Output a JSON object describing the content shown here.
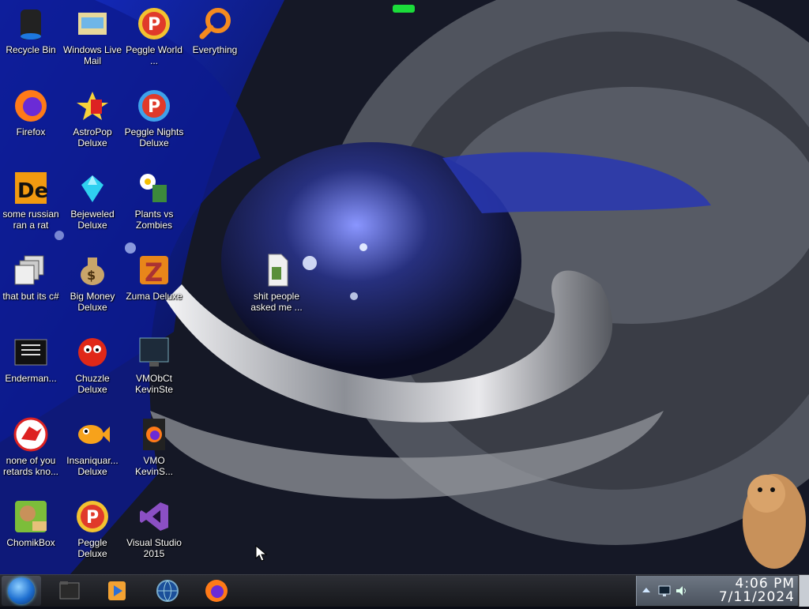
{
  "desktop": {
    "icons": [
      {
        "label": "Recycle Bin",
        "icon": "recycle-bin-icon"
      },
      {
        "label": "Windows Live Mail",
        "icon": "mail-icon"
      },
      {
        "label": "Peggle World ...",
        "icon": "peggle-icon"
      },
      {
        "label": "Everything",
        "icon": "search-icon"
      },
      {
        "label": "Firefox",
        "icon": "firefox-icon"
      },
      {
        "label": "AstroPop Deluxe",
        "icon": "astropop-icon"
      },
      {
        "label": "Peggle Nights Deluxe",
        "icon": "peggle-nights-icon"
      },
      {
        "label": "some russian ran a rat",
        "icon": "de-icon"
      },
      {
        "label": "Bejeweled Deluxe",
        "icon": "gem-icon"
      },
      {
        "label": "Plants vs Zombies",
        "icon": "plant-icon"
      },
      {
        "label": "that but its c#",
        "icon": "windows-stack-icon"
      },
      {
        "label": "Big Money Deluxe",
        "icon": "money-bag-icon"
      },
      {
        "label": "Zuma Deluxe",
        "icon": "zuma-icon"
      },
      {
        "label": "Enderman...",
        "icon": "terminal-icon"
      },
      {
        "label": "Chuzzle Deluxe",
        "icon": "chuzzle-icon"
      },
      {
        "label": "VMObCt KevinSte",
        "icon": "vm-icon"
      },
      {
        "label": "none of you retards kno...",
        "icon": "dino-icon"
      },
      {
        "label": "Insaniquar... Deluxe",
        "icon": "fish-icon"
      },
      {
        "label": "VMO KevinS...",
        "icon": "firefox-file-icon"
      },
      {
        "label": "ChomikBox",
        "icon": "hamster-box-icon"
      },
      {
        "label": "Peggle Deluxe",
        "icon": "peggle-icon"
      },
      {
        "label": "Visual Studio 2015",
        "icon": "visual-studio-icon"
      },
      {
        "label": "shit people asked me ...",
        "icon": "file-icon"
      }
    ]
  },
  "taskbar": {
    "start_icon": "windows-orb-icon",
    "pinned": [
      {
        "icon": "folder-icon"
      },
      {
        "icon": "media-player-icon"
      },
      {
        "icon": "globe-icon"
      },
      {
        "icon": "firefox-icon"
      }
    ],
    "tray": {
      "icons": [
        "show-hidden-icon",
        "network-icon",
        "sound-icon"
      ],
      "time": "4:06 PM",
      "date": "7/11/2024"
    }
  }
}
